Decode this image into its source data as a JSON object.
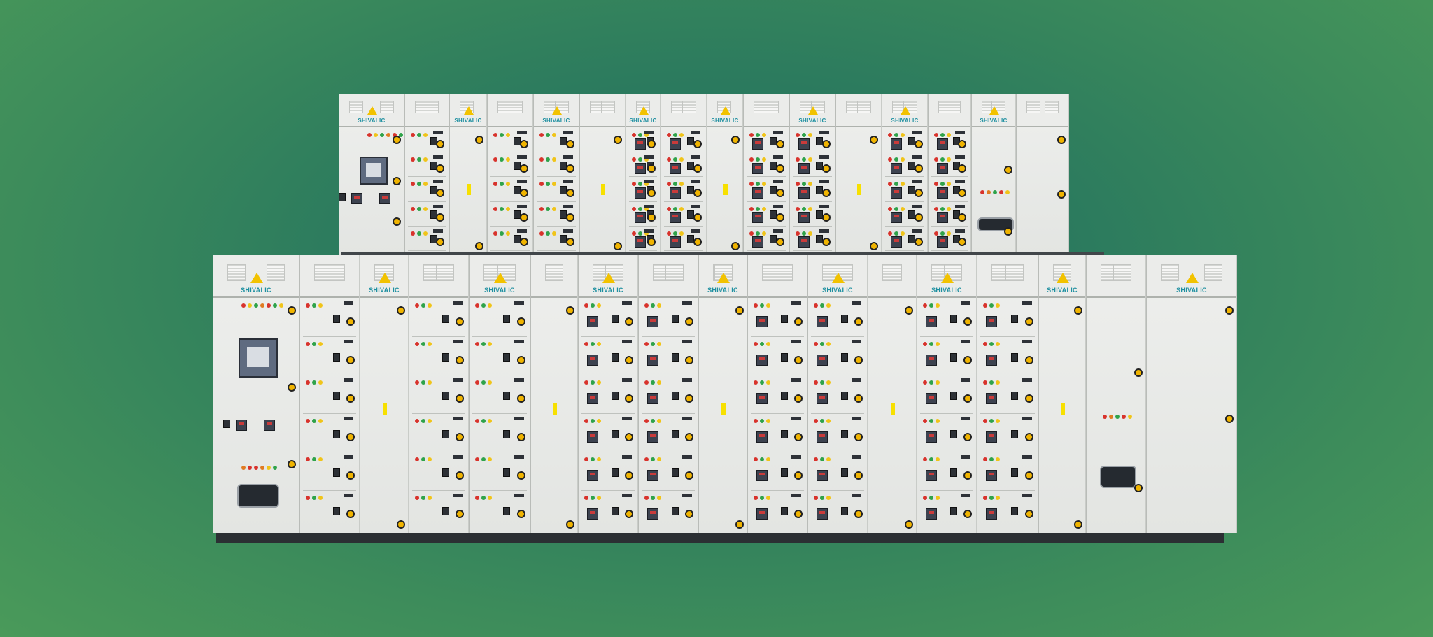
{
  "brand": {
    "name": "SHIVALIC"
  },
  "image": {
    "background_color": "#3d8c5b",
    "accent_colors": {
      "panel": "#e6e7e5",
      "warning": "#f2c200",
      "brand_text": "#1d8fa0"
    }
  },
  "panels": {
    "top_row": {
      "sections": 16
    },
    "bottom_row": {
      "sections": 17
    }
  }
}
